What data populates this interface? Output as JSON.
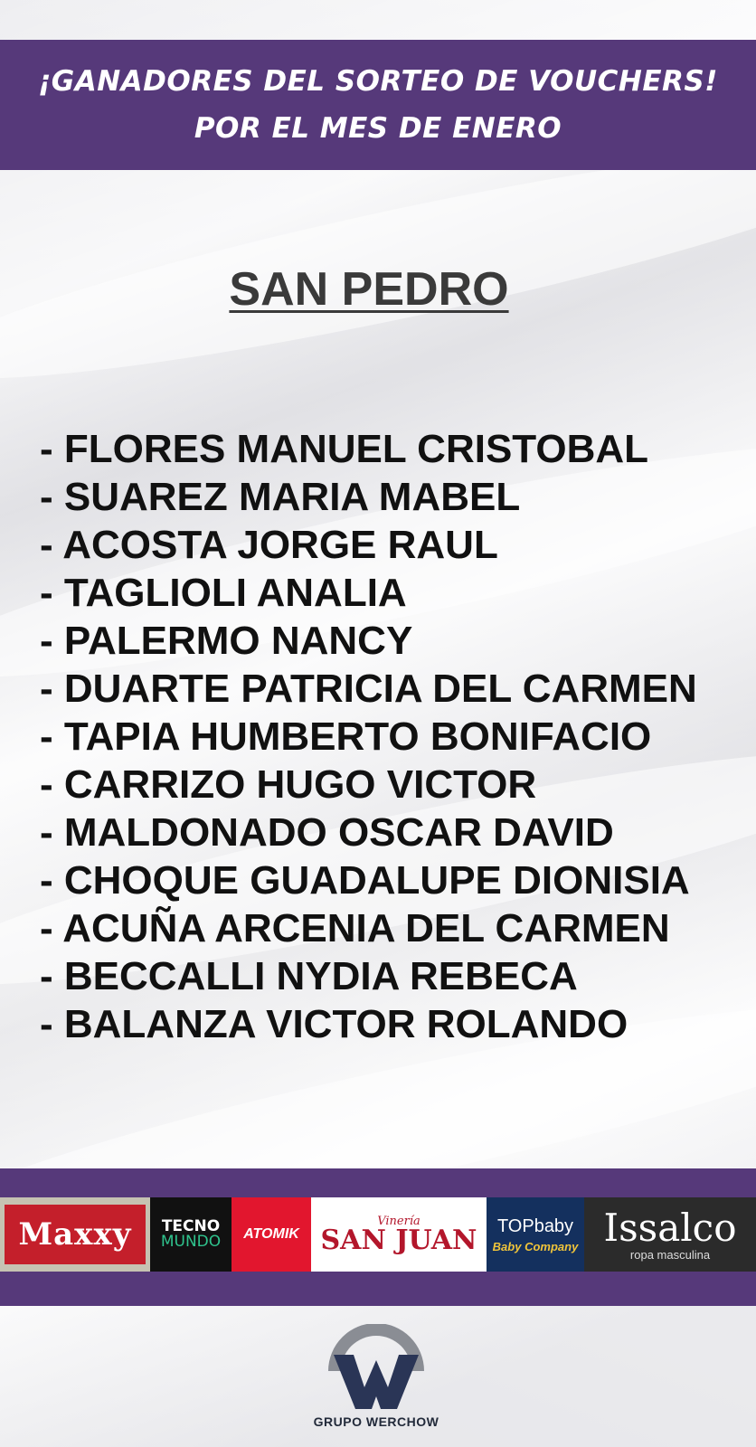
{
  "header": {
    "line1": "¡GANADORES DEL SORTEO DE VOUCHERS!",
    "line2": "POR EL MES DE ENERO"
  },
  "region": "SAN PEDRO",
  "winners": [
    "- FLORES MANUEL CRISTOBAL",
    "- SUAREZ MARIA MABEL",
    "- ACOSTA JORGE RAUL",
    "- TAGLIOLI ANALIA",
    "- PALERMO NANCY",
    "- DUARTE PATRICIA DEL CARMEN",
    "- TAPIA HUMBERTO BONIFACIO",
    "- CARRIZO HUGO VICTOR",
    "- MALDONADO OSCAR DAVID",
    "- CHOQUE GUADALUPE DIONISIA",
    "- ACUÑA ARCENIA DEL CARMEN",
    "- BECCALLI NYDIA REBECA",
    "- BALANZA VICTOR ROLANDO"
  ],
  "logos": {
    "maxxy": "Maxxy",
    "tecno_line1": "TECNO",
    "tecno_line2": "MUNDO",
    "atomik": "ATOMIK",
    "sanjuan_line1": "Vinería",
    "sanjuan_line2": "SAN JUAN",
    "topbaby_line1": "TOPbaby",
    "topbaby_line2": "Baby Company",
    "issalco_line1": "Issalco",
    "issalco_line2": "ropa masculina"
  },
  "brand": {
    "name": "GRUPO WERCHOW"
  },
  "colors": {
    "purple": "#56397a",
    "brand_navy": "#2a3556",
    "brand_gray": "#8a8d94"
  }
}
